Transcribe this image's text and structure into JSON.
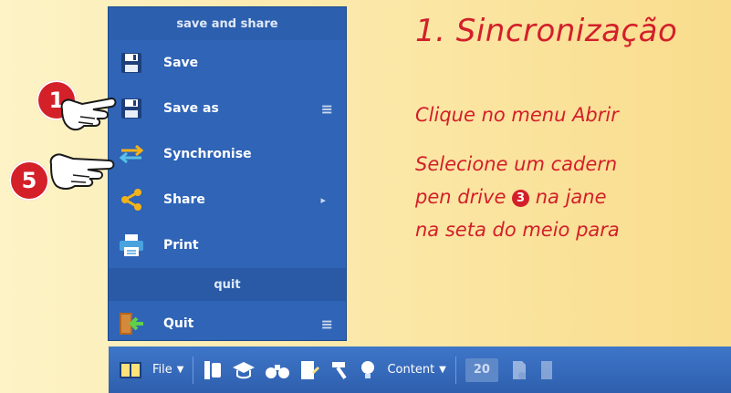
{
  "menu": {
    "sections": {
      "save_share": "save and share",
      "quit": "quit"
    },
    "items": {
      "save": "Save",
      "save_as": "Save as",
      "synchronise": "Synchronise",
      "share": "Share",
      "print": "Print",
      "quit": "Quit"
    },
    "glyphs": {
      "hamburger": "≡",
      "submenu_arrow": "▸"
    }
  },
  "callouts": {
    "one": "1",
    "five": "5"
  },
  "text": {
    "heading": "1. Sincronização",
    "line1": "Clique no menu Abrir",
    "line2": "Selecione um cadern",
    "line3_before": "pen drive ",
    "line3_num": "3",
    "line3_after": " na jane",
    "line4": "na seta do meio para"
  },
  "toolbar": {
    "file_label": "File",
    "content_label": "Content",
    "page_number": "20",
    "dropdown_arrow": "▼"
  },
  "colors": {
    "menu_bg": "#2f64b6",
    "accent_red": "#d31f2a",
    "toolbar_bg": "#3569bb",
    "page_bg": "#fbe7a6"
  }
}
